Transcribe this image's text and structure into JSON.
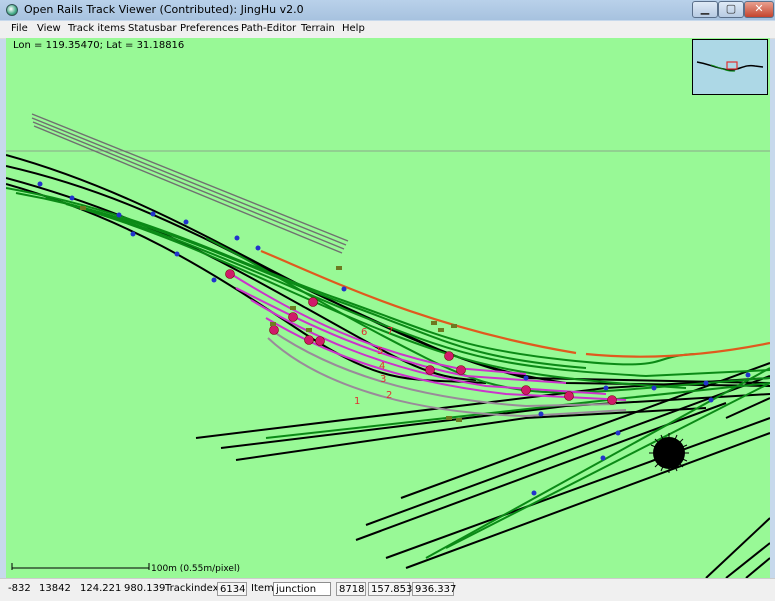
{
  "window": {
    "title": "Open Rails Track Viewer (Contributed): JingHu v2.0",
    "controls": {
      "minimize": "▁",
      "maximize": "▢",
      "close": "✕"
    }
  },
  "menu": [
    "File",
    "View",
    "Track items",
    "Statusbar",
    "Preferences",
    "Path-Editor",
    "Terrain",
    "Help"
  ],
  "canvas": {
    "coordinates": "Lon = 119.35470; Lat = 31.18816",
    "scale_label": "100m (0.55m/pixel)",
    "track_labels": [
      "7",
      "6",
      "5",
      "4",
      "3",
      "2",
      "1"
    ],
    "colors": {
      "background": "#98f996",
      "track": "#000000",
      "track_green": "#0b8a16",
      "path_magenta": "#cc33cc",
      "path_gray": "#9a8a9a",
      "path_orange": "#e05a1e",
      "minimap_water": "#add8e6"
    }
  },
  "statusbar": {
    "x": "-832",
    "z": "13842",
    "tile_x": "124.221",
    "tile_z": "980.139",
    "trackindex_label": "Trackindex",
    "trackindex": "6134",
    "item_label": "Item",
    "item_value": "junction",
    "item_id": "8718",
    "pos_a": "157.853",
    "pos_b": "936.337"
  }
}
